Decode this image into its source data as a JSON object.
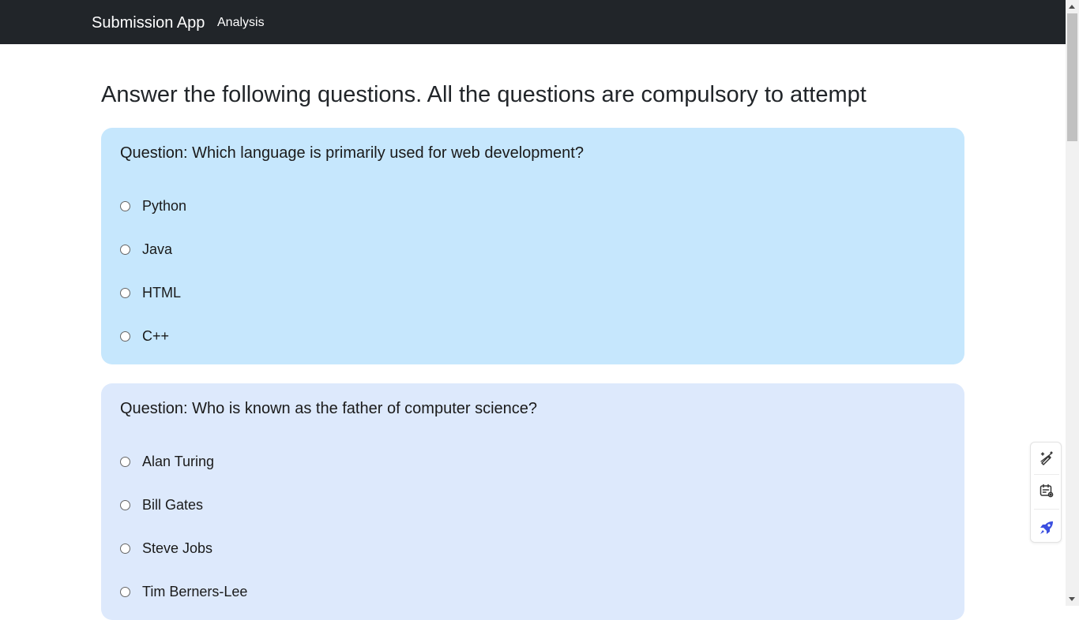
{
  "navbar": {
    "brand": "Submission App",
    "links": [
      "Analysis"
    ]
  },
  "page": {
    "heading": "Answer the following questions. All the questions are compulsory to attempt"
  },
  "questions": [
    {
      "text": "Question: Which language is primarily used for web development?",
      "options": [
        "Python",
        "Java",
        "HTML",
        "C++"
      ],
      "background": "#c6e7fd"
    },
    {
      "text": "Question: Who is known as the father of computer science?",
      "options": [
        "Alan Turing",
        "Bill Gates",
        "Steve Jobs",
        "Tim Berners-Lee"
      ],
      "background": "#dde9fc"
    }
  ],
  "side_tools": {
    "icons": [
      "magic-pen-icon",
      "calendar-settings-icon",
      "rocket-icon"
    ],
    "accent": "#3b4fe0"
  },
  "colors": {
    "navbar": "#212529",
    "text": "#212529"
  }
}
